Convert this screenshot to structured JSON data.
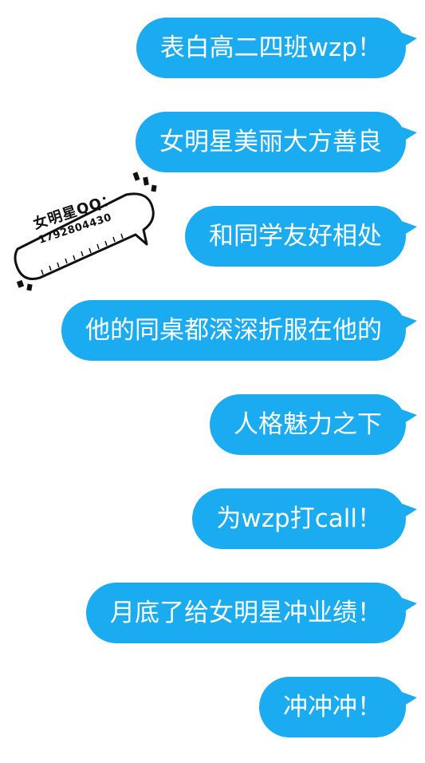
{
  "messages": [
    {
      "text": "表白高二四班wzp！"
    },
    {
      "text": "女明星美丽大方善良"
    },
    {
      "text": "和同学友好相处"
    },
    {
      "text": "他的同桌都深深折服在他的"
    },
    {
      "text": "人格魅力之下"
    },
    {
      "text": "为wzp打call！"
    },
    {
      "text": "月底了给女明星冲业绩！"
    },
    {
      "text": "冲冲冲！"
    }
  ],
  "sticker": {
    "label": "女明星QQ：",
    "number": "1792804430"
  },
  "colors": {
    "bubble": "#1aabf0",
    "bubble_text": "#ffffff",
    "background": "#ffffff"
  }
}
